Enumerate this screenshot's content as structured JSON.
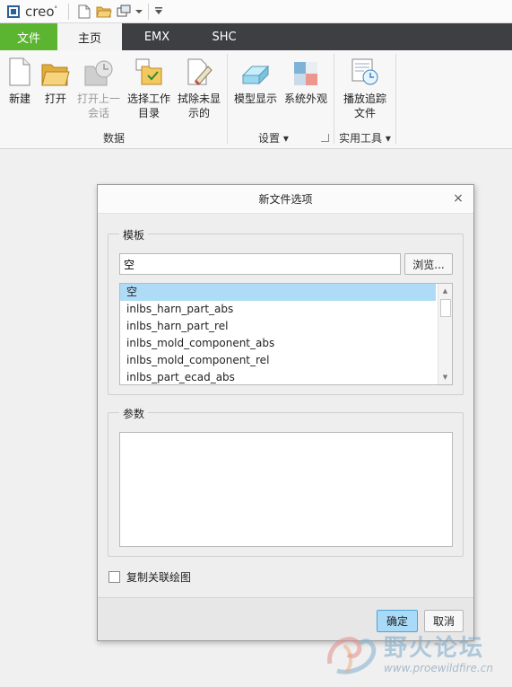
{
  "app": {
    "brand": "creo",
    "brand_mark": "°"
  },
  "quick_access": [
    {
      "name": "new-doc-icon"
    },
    {
      "name": "open-folder-icon"
    },
    {
      "name": "window-icon"
    },
    {
      "name": "dropdown-arrow-icon"
    },
    {
      "name": "customize-arrow-icon"
    }
  ],
  "tabs": [
    {
      "label": "文件"
    },
    {
      "label": "主页"
    },
    {
      "label": "EMX"
    },
    {
      "label": "SHC"
    }
  ],
  "ribbon": {
    "buttons": [
      {
        "line1": "新建",
        "line2": ""
      },
      {
        "line1": "打开",
        "line2": ""
      },
      {
        "line1": "打开上一",
        "line2": "会话"
      },
      {
        "line1": "选择工作",
        "line2": "目录"
      },
      {
        "line1": "拭除未显",
        "line2": "示的"
      },
      {
        "line1": "模型显示",
        "line2": ""
      },
      {
        "line1": "系统外观",
        "line2": ""
      },
      {
        "line1": "播放追踪",
        "line2": "文件"
      }
    ],
    "groups": [
      {
        "label": "数据"
      },
      {
        "label": "设置 ▾"
      },
      {
        "label": "实用工具 ▾"
      }
    ]
  },
  "dialog": {
    "title": "新文件选项",
    "close": "×",
    "template_legend": "模板",
    "template_value": "空",
    "browse_label": "浏览...",
    "template_list": [
      "空",
      "inlbs_harn_part_abs",
      "inlbs_harn_part_rel",
      "inlbs_mold_component_abs",
      "inlbs_mold_component_rel",
      "inlbs_part_ecad_abs"
    ],
    "selected_index": 0,
    "params_legend": "参数",
    "checkbox_label": "复制关联绘图",
    "checkbox_checked": false,
    "ok_label": "确定",
    "cancel_label": "取消"
  },
  "watermark": {
    "text": "野火论坛",
    "url": "www.proewildfire.cn"
  },
  "colors": {
    "file_tab": "#5cb531",
    "tab_bar": "#3d3f42",
    "selected_item": "#aedcf6",
    "ok_button": "#a9daf7"
  }
}
